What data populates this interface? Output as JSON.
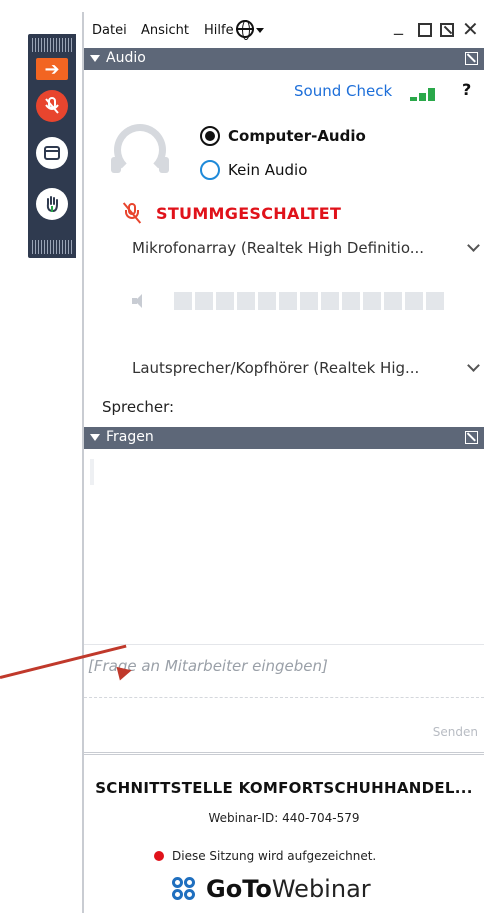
{
  "menu": {
    "file": "Datei",
    "view": "Ansicht",
    "help": "Hilfe"
  },
  "window_controls": {
    "minimize": "_",
    "close": "✕"
  },
  "audio": {
    "section_label": "Audio",
    "sound_check": "Sound Check",
    "help_mark": "?",
    "options": {
      "computer": "Computer-Audio",
      "none": "Kein Audio"
    },
    "selected": "Computer-Audio",
    "muted_label": "STUMMGESCHALTET",
    "microphone": "Mikrofonarray (Realtek High Definitio...",
    "speaker": "Lautsprecher/Kopfhörer (Realtek Hig...",
    "speaker_label": "Sprecher:",
    "speaker_level_fraction": 0
  },
  "questions": {
    "section_label": "Fragen",
    "placeholder": "[Frage an Mitarbeiter eingeben]",
    "send": "Senden"
  },
  "footer": {
    "title": "SCHNITTSTELLE KOMFORTSCHUHHANDEL...",
    "webinar_id": "Webinar-ID: 440-704-579",
    "recording": "Diese Sitzung wird aufgezeichnet.",
    "logo_bold": "GoTo",
    "logo_light": "Webinar"
  },
  "colors": {
    "accent_orange": "#f26522",
    "mute_red": "#e0121a",
    "link_blue": "#1e6fd9",
    "section_bar": "#5d6778",
    "tab_bg": "#2f3a4f",
    "annotation_arrow": "#c0392b"
  },
  "icons": {
    "tab": [
      "arrow-right-icon",
      "microphone-muted-icon",
      "window-icon",
      "raise-hand-icon"
    ],
    "panel": [
      "globe-icon",
      "headset-icon",
      "speaker-icon",
      "popout-icon"
    ]
  }
}
